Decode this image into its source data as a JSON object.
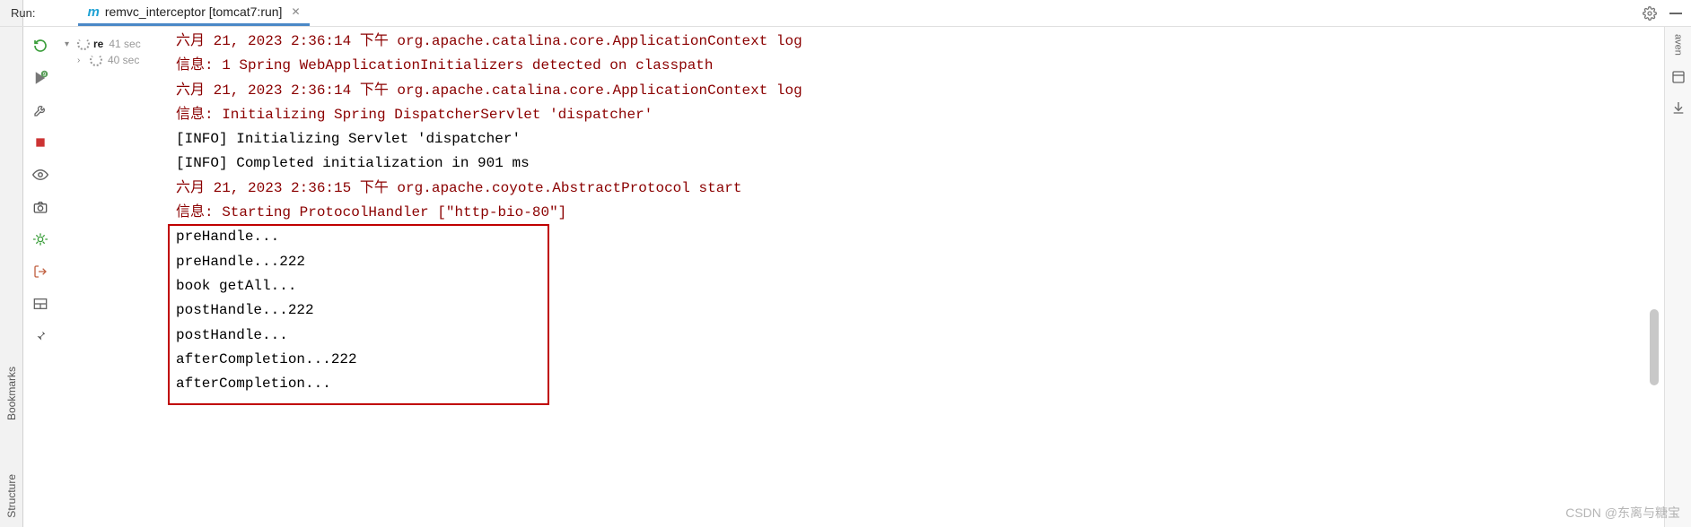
{
  "header": {
    "run_label": "Run:",
    "tab_label": "remvc_interceptor [tomcat7:run]"
  },
  "left_tabs": {
    "bookmarks": "Bookmarks",
    "structure": "Structure"
  },
  "right_tabs": {
    "maven": "aven"
  },
  "tree": {
    "root_name": "re",
    "root_time": "41 sec",
    "child_time": "40 sec"
  },
  "console_lines": [
    {
      "cls": "red",
      "text": "六月 21, 2023 2:36:14 下午 org.apache.catalina.core.ApplicationContext log"
    },
    {
      "cls": "red",
      "text": "信息: 1 Spring WebApplicationInitializers detected on classpath"
    },
    {
      "cls": "red",
      "text": "六月 21, 2023 2:36:14 下午 org.apache.catalina.core.ApplicationContext log"
    },
    {
      "cls": "red",
      "text": "信息: Initializing Spring DispatcherServlet 'dispatcher'"
    },
    {
      "cls": "blk",
      "text": "[INFO] Initializing Servlet 'dispatcher'"
    },
    {
      "cls": "blk",
      "text": "[INFO] Completed initialization in 901 ms"
    },
    {
      "cls": "red",
      "text": "六月 21, 2023 2:36:15 下午 org.apache.coyote.AbstractProtocol start"
    },
    {
      "cls": "red",
      "text": "信息: Starting ProtocolHandler [\"http-bio-80\"]"
    },
    {
      "cls": "blk",
      "text": "preHandle..."
    },
    {
      "cls": "blk",
      "text": "preHandle...222"
    },
    {
      "cls": "blk",
      "text": "book getAll..."
    },
    {
      "cls": "blk",
      "text": "postHandle...222"
    },
    {
      "cls": "blk",
      "text": "postHandle..."
    },
    {
      "cls": "blk",
      "text": "afterCompletion...222"
    },
    {
      "cls": "blk",
      "text": "afterCompletion..."
    }
  ],
  "watermark": "CSDN @东离与糖宝"
}
